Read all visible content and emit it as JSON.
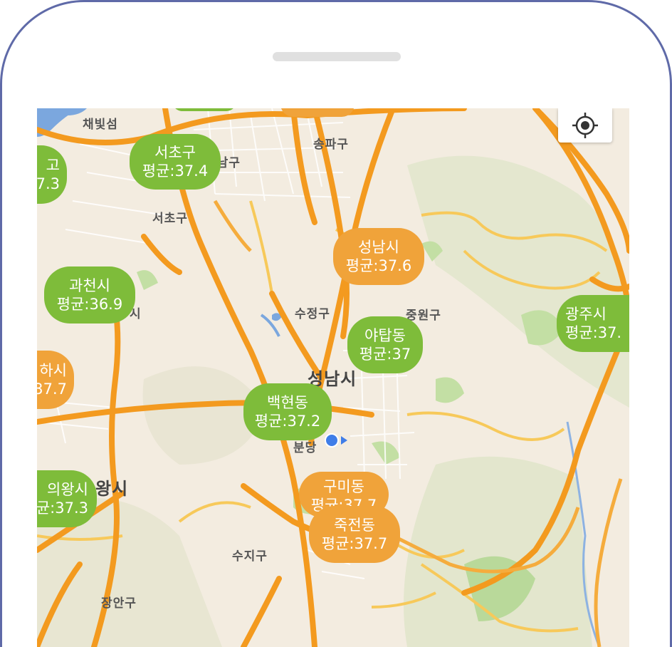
{
  "colors": {
    "frame": "#5f6aa8",
    "green_marker": "#7ebc3a",
    "orange_marker": "#f0a33a",
    "road": "#f39a1f",
    "water": "#7ba7de",
    "user_location": "#3f7de8"
  },
  "locate_button": {
    "icon": "crosshair-icon"
  },
  "place_labels": {
    "chaebitseom": "채빛섬",
    "gangnamgu": "강남구",
    "songpagu": "송파구",
    "seochogu": "서초구",
    "sujeonggu": "수정구",
    "jungwongu": "중원구",
    "seongnamsi": "성남시",
    "bundang": "분당",
    "uiwangsi_partial": "왕시",
    "suji": "수지구",
    "jangangu": "장안구",
    "gwacheon_partial": "시"
  },
  "markers": [
    {
      "name": "서초구",
      "value": "평균:37.4",
      "color": "green"
    },
    {
      "name": "고",
      "value": "7.3",
      "color": "green"
    },
    {
      "name": "성남시",
      "value": "평균:37.6",
      "color": "orange"
    },
    {
      "name": "과천시",
      "value": "평균:36.9",
      "color": "green"
    },
    {
      "name": "광주시",
      "value": "평균:37.",
      "color": "green"
    },
    {
      "name": "야탑동",
      "value": "평균:37",
      "color": "green"
    },
    {
      "name": "하시",
      "value": "37.7",
      "color": "orange"
    },
    {
      "name": "백현동",
      "value": "평균:37.2",
      "color": "green"
    },
    {
      "name": "의왕시",
      "value": "균:37.3",
      "color": "green"
    },
    {
      "name": "구미동",
      "value": "평균:37.7",
      "color": "orange"
    },
    {
      "name": "죽전동",
      "value": "평균:37.7",
      "color": "orange"
    }
  ]
}
